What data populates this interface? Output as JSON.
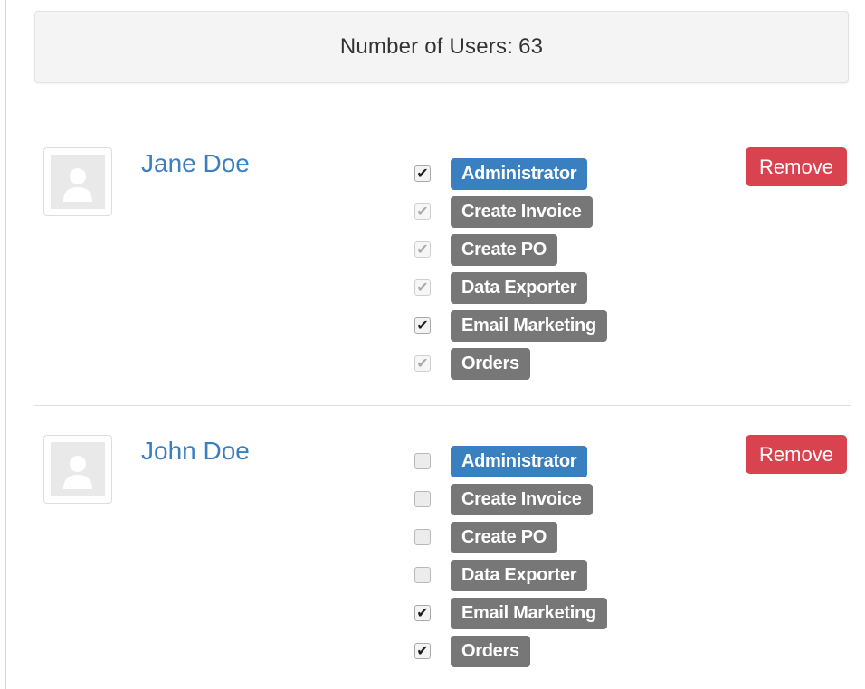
{
  "summary": {
    "label": "Number of Users:",
    "count": "63"
  },
  "users": [
    {
      "name": "Jane Doe",
      "remove_label": "Remove",
      "avatar_icon": "user-placeholder-icon",
      "roles": [
        {
          "label": "Administrator",
          "checked": true,
          "disabled": false,
          "color": "#3a7fc0"
        },
        {
          "label": "Create Invoice",
          "checked": true,
          "disabled": true,
          "color": "#777777"
        },
        {
          "label": "Create PO",
          "checked": true,
          "disabled": true,
          "color": "#777777"
        },
        {
          "label": "Data Exporter",
          "checked": true,
          "disabled": true,
          "color": "#777777"
        },
        {
          "label": "Email Marketing",
          "checked": true,
          "disabled": false,
          "color": "#777777"
        },
        {
          "label": "Orders",
          "checked": true,
          "disabled": true,
          "color": "#777777"
        }
      ]
    },
    {
      "name": "John Doe",
      "remove_label": "Remove",
      "avatar_icon": "user-placeholder-icon",
      "roles": [
        {
          "label": "Administrator",
          "checked": false,
          "disabled": false,
          "color": "#3a7fc0"
        },
        {
          "label": "Create Invoice",
          "checked": false,
          "disabled": false,
          "color": "#777777"
        },
        {
          "label": "Create PO",
          "checked": false,
          "disabled": false,
          "color": "#777777"
        },
        {
          "label": "Data Exporter",
          "checked": false,
          "disabled": false,
          "color": "#777777"
        },
        {
          "label": "Email Marketing",
          "checked": true,
          "disabled": false,
          "color": "#777777"
        },
        {
          "label": "Orders",
          "checked": true,
          "disabled": false,
          "color": "#777777"
        }
      ]
    }
  ],
  "colors": {
    "link": "#3a7fc0",
    "danger": "#d9434f",
    "primary_label": "#3a7fc0",
    "default_label": "#777777"
  }
}
